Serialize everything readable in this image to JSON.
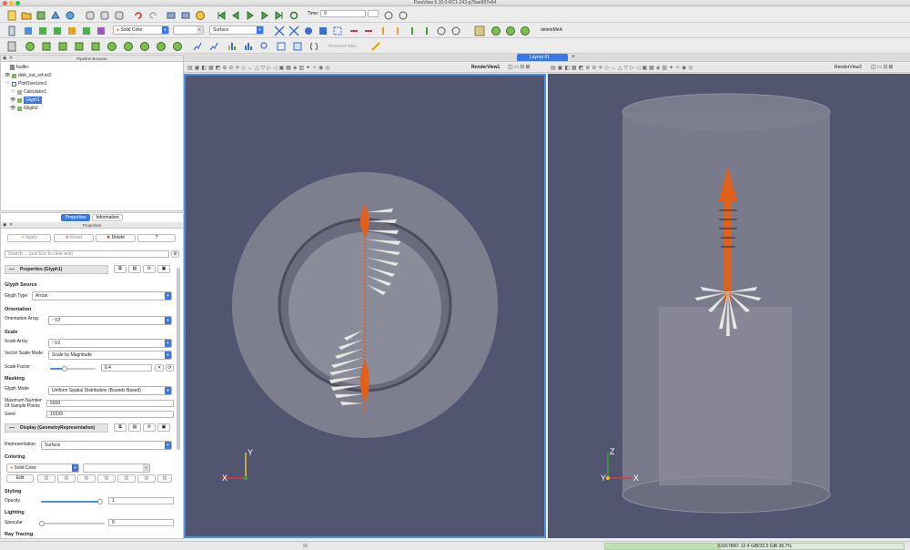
{
  "window": {
    "title": "ParaView 5.10.0-RC1-243-g76ae997e64"
  },
  "toolbar": {
    "time_label": "Time:",
    "time_value": "0",
    "color_by": "Solid Color",
    "representation": "Surface",
    "macro_label": "deleteMeA",
    "threshold_label": "Threshold Table"
  },
  "pipeline": {
    "title": "Pipeline Browser",
    "items": [
      {
        "label": "builtin:"
      },
      {
        "label": "disk_out_ref.ex2"
      },
      {
        "label": "PlotOverLine1"
      },
      {
        "label": "Calculator1"
      },
      {
        "label": "Glyph1"
      },
      {
        "label": "Glyph2"
      }
    ]
  },
  "props": {
    "tab_properties": "Properties",
    "tab_information": "Information",
    "panel_title": "Properties",
    "apply": "Apply",
    "reset": "Reset",
    "delete": "Delete",
    "help": "?",
    "search_placeholder": "Search ... (use Esc to clear text)",
    "section_glyph": "Properties (Glyph1)",
    "glyph_source": "Glyph Source",
    "glyph_type_label": "Glyph Type",
    "glyph_type_value": "Arrow",
    "orientation": "Orientation",
    "orientation_array_label": "Orientation Array",
    "orientation_array_value": "V2",
    "scale": "Scale",
    "scale_array_label": "Scale Array",
    "scale_array_value": "V2",
    "vector_scale_mode_label": "Vector Scale Mode",
    "vector_scale_mode_value": "Scale by Magnitude",
    "scale_factor_label": "Scale Factor",
    "scale_factor_value": "0.4",
    "masking": "Masking",
    "glyph_mode_label": "Glyph Mode",
    "glyph_mode_value": "Uniform Spatial Distribution (Bounds Based)",
    "max_points_label_1": "Maximum Number",
    "max_points_label_2": "Of Sample Points",
    "max_points_value": "5000",
    "seed_label": "Seed",
    "seed_value": "10339",
    "section_display": "Display (GeometryRepresentation)",
    "representation_label": "Representation",
    "representation_value": "Surface",
    "coloring": "Coloring",
    "coloring_value": "Solid Color",
    "edit": "Edit",
    "styling": "Styling",
    "opacity_label": "Opacity",
    "opacity_value": "1",
    "lighting": "Lighting",
    "specular_label": "Specular",
    "specular_value": "0",
    "ray_tracing": "Ray Tracing"
  },
  "layout": {
    "tab_label": "Layout #1",
    "add_tab": "+",
    "view1_label": "RenderView1",
    "view2_label": "RenderView2"
  },
  "axes": {
    "x": "X",
    "y": "Y",
    "z": "Z"
  },
  "status": {
    "memory": "S1067860: 12.4 GiB/32.0 GiB 38.7%",
    "memory_fraction": 0.387
  },
  "colors": {
    "glyph_orange": "#e0601c",
    "render_bg": "#525570",
    "accent": "#3b78e7"
  }
}
